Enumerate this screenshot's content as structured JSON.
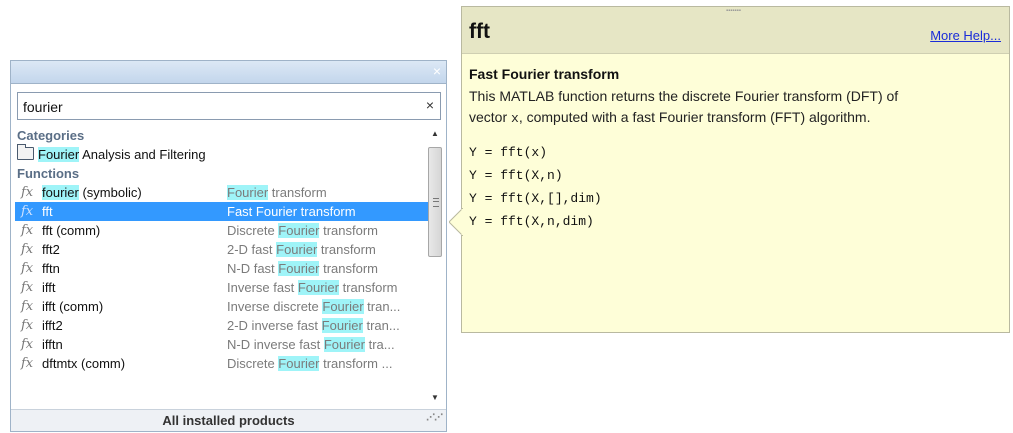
{
  "browser": {
    "close_glyph": "×",
    "search_value": "fourier",
    "clear_glyph": "×",
    "categories_header": "Categories",
    "category": {
      "highlight": "Fourier",
      "rest": " Analysis and Filtering"
    },
    "functions_header": "Functions",
    "functions": [
      {
        "name_hl": "fourier",
        "name_rest": " (symbolic)",
        "desc_pre": "",
        "desc_hl": "Fourier",
        "desc_post": " transform",
        "selected": false
      },
      {
        "name_hl": "",
        "name_rest": "fft",
        "desc_pre": "Fast Fourier transform",
        "desc_hl": "",
        "desc_post": "",
        "selected": true
      },
      {
        "name_hl": "",
        "name_rest": "fft (comm)",
        "desc_pre": "Discrete ",
        "desc_hl": "Fourier",
        "desc_post": " transform",
        "selected": false
      },
      {
        "name_hl": "",
        "name_rest": "fft2",
        "desc_pre": "2-D fast ",
        "desc_hl": "Fourier",
        "desc_post": " transform",
        "selected": false
      },
      {
        "name_hl": "",
        "name_rest": "fftn",
        "desc_pre": "N-D fast ",
        "desc_hl": "Fourier",
        "desc_post": " transform",
        "selected": false
      },
      {
        "name_hl": "",
        "name_rest": "ifft",
        "desc_pre": "Inverse fast ",
        "desc_hl": "Fourier",
        "desc_post": " transform",
        "selected": false
      },
      {
        "name_hl": "",
        "name_rest": "ifft (comm)",
        "desc_pre": "Inverse discrete ",
        "desc_hl": "Fourier",
        "desc_post": " tran...",
        "selected": false
      },
      {
        "name_hl": "",
        "name_rest": "ifft2",
        "desc_pre": "2-D inverse fast ",
        "desc_hl": "Fourier",
        "desc_post": " tran...",
        "selected": false
      },
      {
        "name_hl": "",
        "name_rest": "ifftn",
        "desc_pre": "N-D inverse fast ",
        "desc_hl": "Fourier",
        "desc_post": " tra...",
        "selected": false
      },
      {
        "name_hl": "",
        "name_rest": "dftmtx (comm)",
        "desc_pre": "Discrete ",
        "desc_hl": "Fourier",
        "desc_post": " transform ...",
        "selected": false
      }
    ],
    "fx_glyph": "fx",
    "footer": "All installed products"
  },
  "help": {
    "title": "fft",
    "more_help": "More Help...",
    "subtitle": "Fast Fourier transform",
    "desc_part1": "This MATLAB function returns the discrete Fourier transform (DFT) of",
    "desc_part2a": "vector ",
    "desc_code": "x",
    "desc_part2b": ", computed with a fast Fourier transform (FFT) algorithm.",
    "syntax": [
      "Y = fft(x)",
      "Y = fft(X,n)",
      "Y = fft(X,[],dim)",
      "Y = fft(X,n,dim)"
    ]
  },
  "colors": {
    "selection": "#3399ff",
    "highlight": "#9ff4f8",
    "popup_bg": "#fefed8"
  }
}
